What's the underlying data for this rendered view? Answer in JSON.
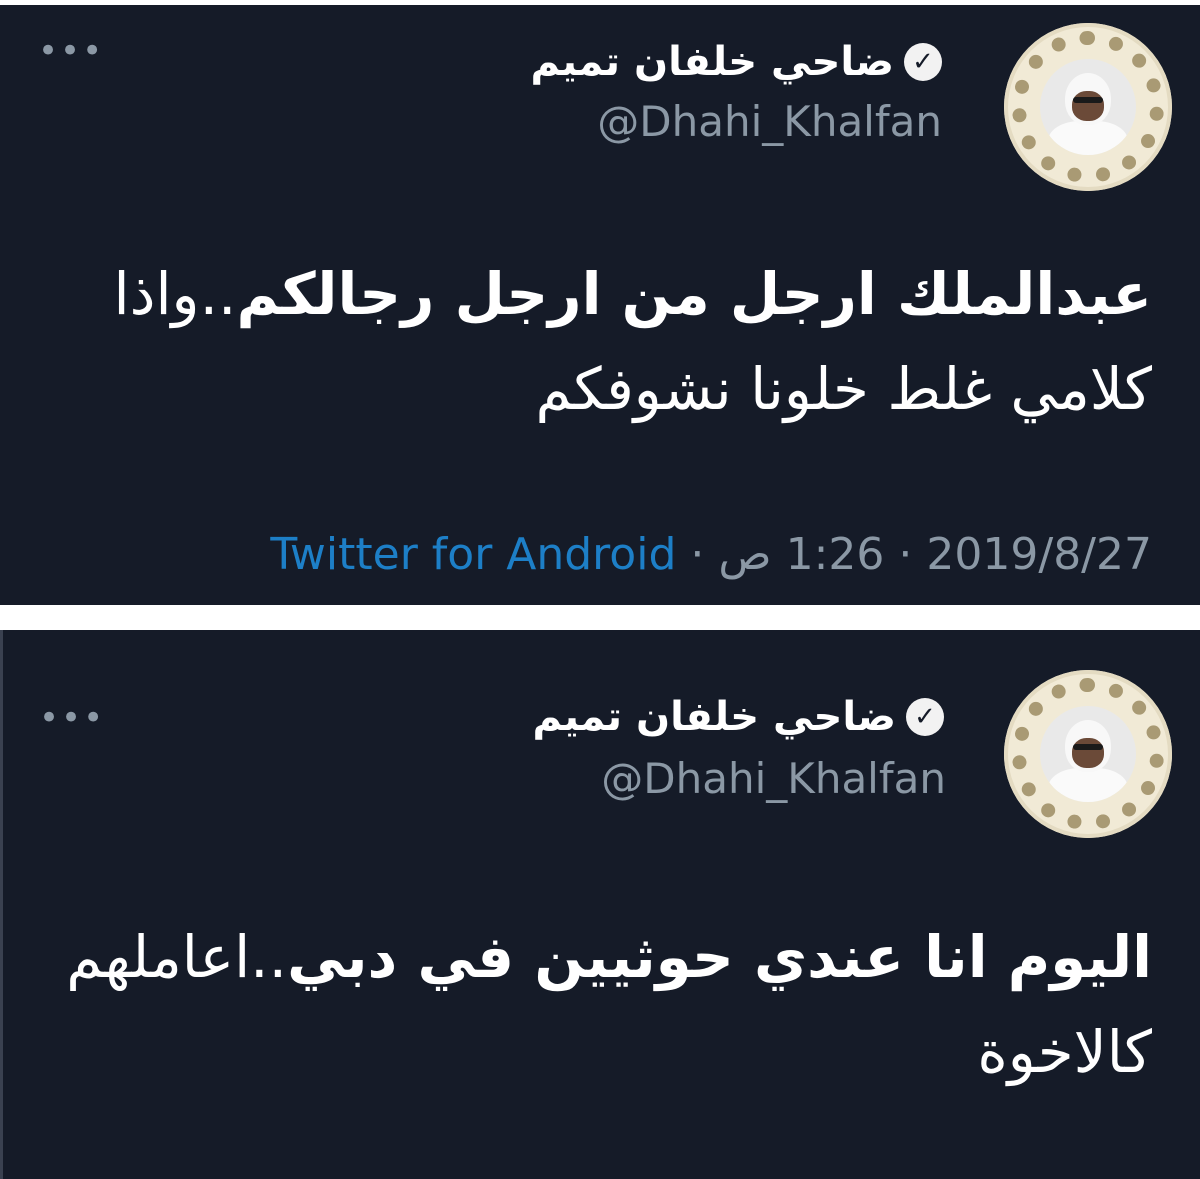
{
  "tweets": [
    {
      "display_name": "ضاحي خلفان تميم",
      "handle": "@Dhahi_Khalfan",
      "verified_icon": "verified-badge-icon",
      "more_icon": "more-options-icon",
      "text_bold": "عبدالملك ارجل من ارجل رجالكم",
      "text_rest": "..واذا كلامي غلط خلونا نشوفكم",
      "date": "2019/8/27",
      "time": "1:26 ص",
      "source": "Twitter for Android",
      "separator": "·"
    },
    {
      "display_name": "ضاحي خلفان تميم",
      "handle": "@Dhahi_Khalfan",
      "verified_icon": "verified-badge-icon",
      "more_icon": "more-options-icon",
      "text_bold": "اليوم انا عندي حوثيين في دبي",
      "text_rest": "..اعاملهم كالاخوة"
    }
  ],
  "colors": {
    "background": "#151b28",
    "secondary_text": "#8b98a5",
    "link": "#1d7fc7"
  }
}
